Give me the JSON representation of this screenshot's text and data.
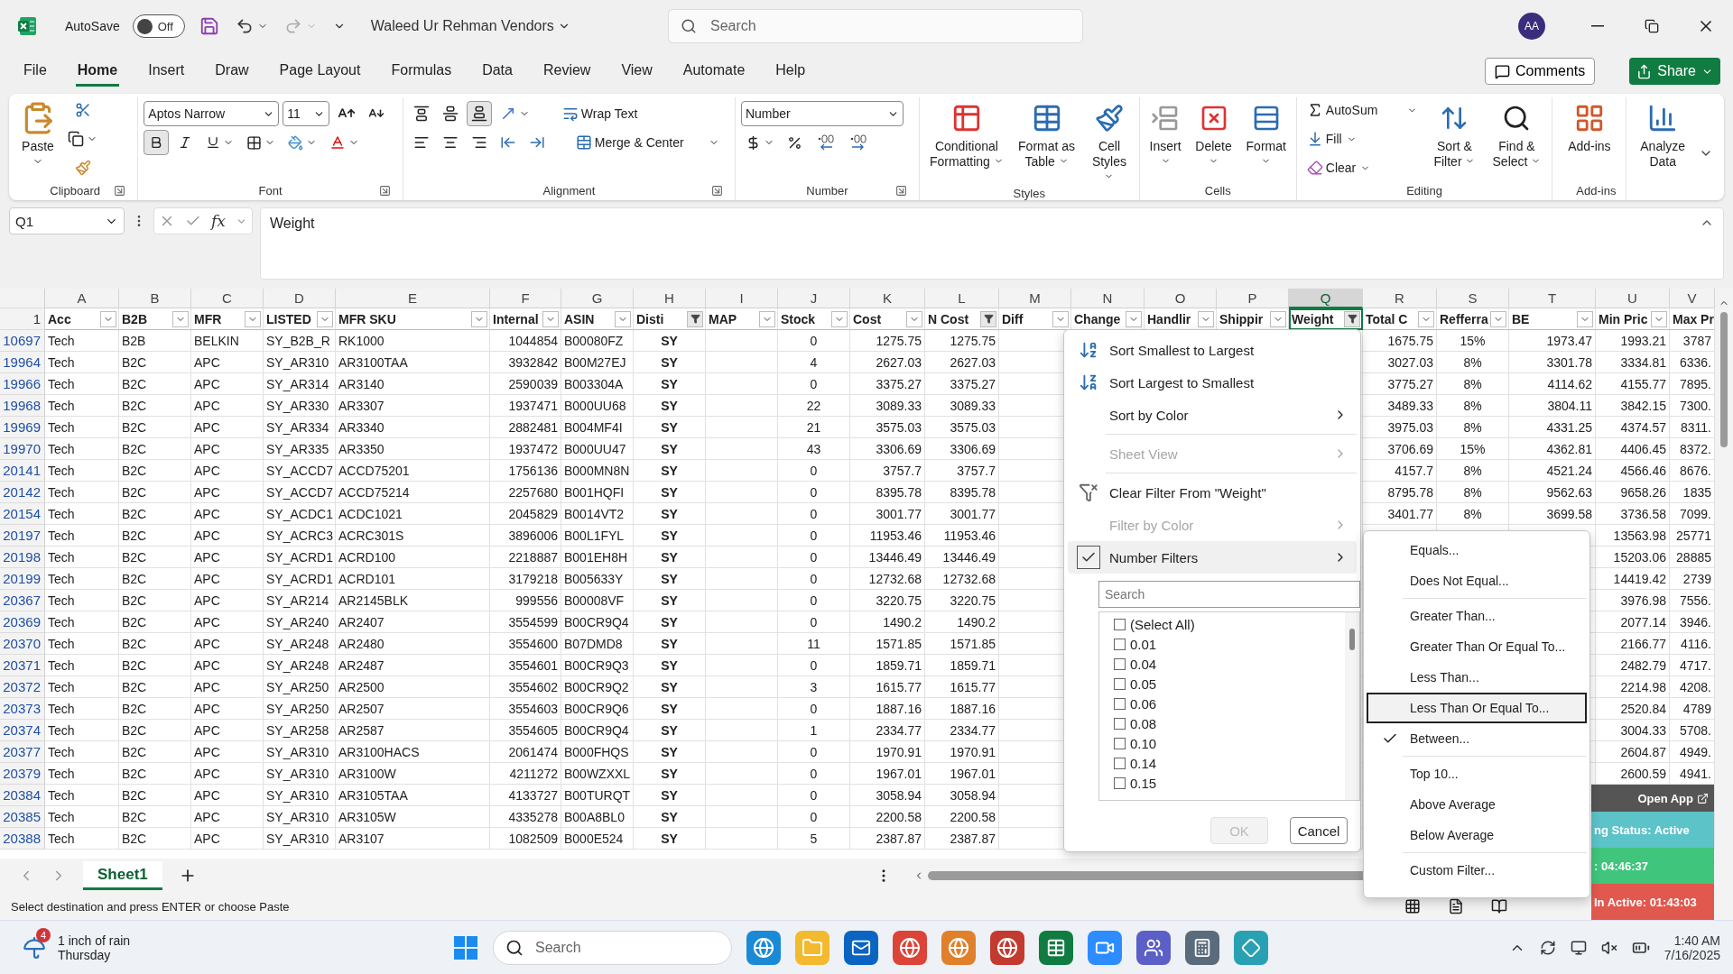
{
  "titlebar": {
    "autosave": {
      "label": "AutoSave",
      "state": "Off",
      "on": false
    },
    "title": "Waleed Ur Rehman Vendors",
    "search": {
      "placeholder": "Search"
    },
    "avatar": "AA"
  },
  "menu_tabs": [
    {
      "label": "File",
      "selected": false
    },
    {
      "label": "Home",
      "selected": true
    },
    {
      "label": "Insert",
      "selected": false
    },
    {
      "label": "Draw",
      "selected": false
    },
    {
      "label": "Page Layout",
      "selected": false
    },
    {
      "label": "Formulas",
      "selected": false
    },
    {
      "label": "Data",
      "selected": false
    },
    {
      "label": "Review",
      "selected": false
    },
    {
      "label": "View",
      "selected": false
    },
    {
      "label": "Automate",
      "selected": false
    },
    {
      "label": "Help",
      "selected": false
    }
  ],
  "actions": {
    "comments": "Comments",
    "share": "Share"
  },
  "ribbon": {
    "clipboard": {
      "label": "Clipboard",
      "paste": "Paste"
    },
    "font": {
      "label": "Font",
      "font": "Aptos Narrow",
      "size": "11",
      "bold": true
    },
    "alignment": {
      "label": "Alignment",
      "wrap": "Wrap Text",
      "merge": "Merge & Center",
      "bottom_align": true
    },
    "number": {
      "label": "Number",
      "format": "Number"
    },
    "styles": {
      "label": "Styles",
      "buttons": [
        "Conditional Formatting",
        "Format as Table",
        "Cell Styles"
      ]
    },
    "cells": {
      "label": "Cells",
      "buttons": [
        "Insert",
        "Delete",
        "Format"
      ]
    },
    "editing": {
      "label": "Editing",
      "small": [
        "AutoSum",
        "Fill",
        "Clear"
      ],
      "buttons": [
        "Sort & Filter",
        "Find & Select"
      ]
    },
    "addins": {
      "label": "Add-ins",
      "buttons": [
        "Add-ins"
      ]
    },
    "analyze": {
      "buttons": [
        "Analyze Data"
      ]
    }
  },
  "formula_bar": {
    "name_box": "Q1",
    "fx": "fx",
    "formula": "Weight"
  },
  "sheet": {
    "header_row": "1",
    "columns": [
      {
        "letter": "A",
        "header": "Acc",
        "filtered": false,
        "selected": false
      },
      {
        "letter": "B",
        "header": "B2B",
        "filtered": false,
        "selected": false
      },
      {
        "letter": "C",
        "header": "MFR",
        "filtered": false,
        "selected": false
      },
      {
        "letter": "D",
        "header": "LISTED",
        "filtered": false,
        "selected": false
      },
      {
        "letter": "E",
        "header": "MFR SKU",
        "filtered": false,
        "selected": false
      },
      {
        "letter": "F",
        "header": "Internal",
        "filtered": false,
        "selected": false
      },
      {
        "letter": "G",
        "header": "ASIN",
        "filtered": false,
        "selected": false
      },
      {
        "letter": "H",
        "header": "Disti",
        "filtered": true,
        "selected": false
      },
      {
        "letter": "I",
        "header": "MAP",
        "filtered": false,
        "selected": false
      },
      {
        "letter": "J",
        "header": "Stock",
        "filtered": false,
        "selected": false
      },
      {
        "letter": "K",
        "header": "Cost",
        "filtered": false,
        "selected": false
      },
      {
        "letter": "L",
        "header": "N Cost",
        "filtered": true,
        "selected": false
      },
      {
        "letter": "M",
        "header": "Diff",
        "filtered": false,
        "selected": false
      },
      {
        "letter": "N",
        "header": "Change",
        "filtered": false,
        "selected": false
      },
      {
        "letter": "O",
        "header": "Handlir",
        "filtered": false,
        "selected": false
      },
      {
        "letter": "P",
        "header": "Shippir",
        "filtered": false,
        "selected": false
      },
      {
        "letter": "Q",
        "header": "Weight",
        "filtered": true,
        "selected": true
      },
      {
        "letter": "R",
        "header": "Total C",
        "filtered": false,
        "selected": false
      },
      {
        "letter": "S",
        "header": "Refferra",
        "filtered": false,
        "selected": false
      },
      {
        "letter": "T",
        "header": "BE",
        "filtered": false,
        "selected": false
      },
      {
        "letter": "U",
        "header": "Min Pric",
        "filtered": false,
        "selected": false
      },
      {
        "letter": "V",
        "header": "Max Pr",
        "selected": false
      }
    ],
    "rows": [
      {
        "num": "10697",
        "cells": [
          "Tech",
          "B2B",
          "BELKIN",
          "SY_B2B_R",
          "RK1000",
          "1044854",
          "B00080FZ",
          "SY",
          "",
          "0",
          "1275.75",
          "1275.75"
        ],
        "tail": [
          "1675.75",
          "15%",
          "1973.47",
          "1993.21",
          "3787"
        ]
      },
      {
        "num": "19964",
        "cells": [
          "Tech",
          "B2C",
          "APC",
          "SY_AR310",
          "AR3100TAA",
          "3932842",
          "B00M27EJ",
          "SY",
          "",
          "4",
          "2627.03",
          "2627.03"
        ],
        "tail": [
          "3027.03",
          "8%",
          "3301.78",
          "3334.81",
          "6336."
        ]
      },
      {
        "num": "19966",
        "cells": [
          "Tech",
          "B2C",
          "APC",
          "SY_AR314",
          "AR3140",
          "2590039",
          "B003304A",
          "SY",
          "",
          "0",
          "3375.27",
          "3375.27"
        ],
        "tail": [
          "3775.27",
          "8%",
          "4114.62",
          "4155.77",
          "7895."
        ]
      },
      {
        "num": "19968",
        "cells": [
          "Tech",
          "B2C",
          "APC",
          "SY_AR330",
          "AR3307",
          "1937471",
          "B000UU68",
          "SY",
          "",
          "22",
          "3089.33",
          "3089.33"
        ],
        "tail": [
          "3489.33",
          "8%",
          "3804.11",
          "3842.15",
          "7300."
        ]
      },
      {
        "num": "19969",
        "cells": [
          "Tech",
          "B2C",
          "APC",
          "SY_AR334",
          "AR3340",
          "2882481",
          "B004MF4I",
          "SY",
          "",
          "21",
          "3575.03",
          "3575.03"
        ],
        "tail": [
          "3975.03",
          "8%",
          "4331.25",
          "4374.57",
          "8311."
        ]
      },
      {
        "num": "19970",
        "cells": [
          "Tech",
          "B2C",
          "APC",
          "SY_AR335",
          "AR3350",
          "1937472",
          "B000UU47",
          "SY",
          "",
          "43",
          "3306.69",
          "3306.69"
        ],
        "tail": [
          "3706.69",
          "15%",
          "4362.81",
          "4406.45",
          "8372."
        ]
      },
      {
        "num": "20141",
        "cells": [
          "Tech",
          "B2C",
          "APC",
          "SY_ACCD7",
          "ACCD75201",
          "1756136",
          "B000MN8N",
          "SY",
          "",
          "0",
          "3757.7",
          "3757.7"
        ],
        "tail": [
          "4157.7",
          "8%",
          "4521.24",
          "4566.46",
          "8676."
        ]
      },
      {
        "num": "20142",
        "cells": [
          "Tech",
          "B2C",
          "APC",
          "SY_ACCD7",
          "ACCD75214",
          "2257680",
          "B001HQFI",
          "SY",
          "",
          "0",
          "8395.78",
          "8395.78"
        ],
        "tail": [
          "8795.78",
          "8%",
          "9562.63",
          "9658.26",
          "1835"
        ]
      },
      {
        "num": "20154",
        "cells": [
          "Tech",
          "B2C",
          "APC",
          "SY_ACDC1",
          "ACDC1021",
          "2045829",
          "B0014VT2",
          "SY",
          "",
          "0",
          "3001.77",
          "3001.77"
        ],
        "tail": [
          "3401.77",
          "8%",
          "3699.58",
          "3736.58",
          "7099."
        ]
      },
      {
        "num": "20197",
        "cells": [
          "Tech",
          "B2C",
          "APC",
          "SY_ACRC3",
          "ACRC301S",
          "3896006",
          "B00L1FYL",
          "SY",
          "",
          "0",
          "11953.46",
          "11953.46"
        ],
        "tail": [
          "13563.98",
          "25771"
        ]
      },
      {
        "num": "20198",
        "cells": [
          "Tech",
          "B2C",
          "APC",
          "SY_ACRD1",
          "ACRD100",
          "2218887",
          "B001EH8H",
          "SY",
          "",
          "0",
          "13446.49",
          "13446.49"
        ],
        "tail": [
          "15203.06",
          "28885"
        ]
      },
      {
        "num": "20199",
        "cells": [
          "Tech",
          "B2C",
          "APC",
          "SY_ACRD1",
          "ACRD101",
          "3179218",
          "B005633Y",
          "SY",
          "",
          "0",
          "12732.68",
          "12732.68"
        ],
        "tail": [
          "14419.42",
          "2739"
        ]
      },
      {
        "num": "20367",
        "cells": [
          "Tech",
          "B2C",
          "APC",
          "SY_AR214",
          "AR2145BLK",
          "999556",
          "B00008VF",
          "SY",
          "",
          "0",
          "3220.75",
          "3220.75"
        ],
        "tail": [
          "3976.98",
          "7556."
        ]
      },
      {
        "num": "20369",
        "cells": [
          "Tech",
          "B2C",
          "APC",
          "SY_AR240",
          "AR2407",
          "3554599",
          "B00CR9Q4",
          "SY",
          "",
          "0",
          "1490.2",
          "1490.2"
        ],
        "tail": [
          "2077.14",
          "3946."
        ]
      },
      {
        "num": "20370",
        "cells": [
          "Tech",
          "B2C",
          "APC",
          "SY_AR248",
          "AR2480",
          "3554600",
          "B07DMD8",
          "SY",
          "",
          "11",
          "1571.85",
          "1571.85"
        ],
        "tail": [
          "2166.77",
          "4116."
        ]
      },
      {
        "num": "20371",
        "cells": [
          "Tech",
          "B2C",
          "APC",
          "SY_AR248",
          "AR2487",
          "3554601",
          "B00CR9Q3",
          "SY",
          "",
          "0",
          "1859.71",
          "1859.71"
        ],
        "tail": [
          "2482.79",
          "4717."
        ]
      },
      {
        "num": "20372",
        "cells": [
          "Tech",
          "B2C",
          "APC",
          "SY_AR250",
          "AR2500",
          "3554602",
          "B00CR9Q2",
          "SY",
          "",
          "3",
          "1615.77",
          "1615.77"
        ],
        "tail": [
          "2214.98",
          "4208."
        ]
      },
      {
        "num": "20373",
        "cells": [
          "Tech",
          "B2C",
          "APC",
          "SY_AR250",
          "AR2507",
          "3554603",
          "B00CR9Q6",
          "SY",
          "",
          "0",
          "1887.16",
          "1887.16"
        ],
        "tail": [
          "2520.84",
          "4789"
        ]
      },
      {
        "num": "20374",
        "cells": [
          "Tech",
          "B2C",
          "APC",
          "SY_AR258",
          "AR2587",
          "3554605",
          "B00CR9Q4",
          "SY",
          "",
          "1",
          "2334.77",
          "2334.77"
        ],
        "tail": [
          "3004.33",
          "5708."
        ]
      },
      {
        "num": "20377",
        "cells": [
          "Tech",
          "B2C",
          "APC",
          "SY_AR310",
          "AR3100HACS",
          "2061474",
          "B000FHQS",
          "SY",
          "",
          "0",
          "1970.91",
          "1970.91"
        ],
        "tail": [
          "2604.87",
          "4949."
        ]
      },
      {
        "num": "20379",
        "cells": [
          "Tech",
          "B2C",
          "APC",
          "SY_AR310",
          "AR3100W",
          "4211272",
          "B00WZXXL",
          "SY",
          "",
          "0",
          "1967.01",
          "1967.01"
        ],
        "tail": [
          "2600.59",
          "4941."
        ]
      },
      {
        "num": "20384",
        "cells": [
          "Tech",
          "B2C",
          "APC",
          "SY_AR310",
          "AR3105TAA",
          "4133727",
          "B00TURQT",
          "SY",
          "",
          "0",
          "3058.94",
          "3058.94"
        ]
      },
      {
        "num": "20385",
        "cells": [
          "Tech",
          "B2C",
          "APC",
          "SY_AR310",
          "AR3105W",
          "4335278",
          "B00A8BL0",
          "SY",
          "",
          "0",
          "2200.58",
          "2200.58"
        ]
      },
      {
        "num": "20388",
        "cells": [
          "Tech",
          "B2C",
          "APC",
          "SY_AR310",
          "AR3107",
          "1082509",
          "B000E524",
          "SY",
          "",
          "5",
          "2387.87",
          "2387.87"
        ]
      }
    ]
  },
  "filter_menu": {
    "items": [
      {
        "kind": "sort_asc",
        "label": "Sort Smallest to Largest",
        "disabled": false,
        "submenu": false,
        "checked": false,
        "selected": false,
        "separator_before": false
      },
      {
        "kind": "sort_desc",
        "label": "Sort Largest to Smallest",
        "disabled": false,
        "submenu": false,
        "checked": false,
        "selected": false,
        "separator_before": false
      },
      {
        "kind": "plain",
        "label": "Sort by Color",
        "disabled": false,
        "submenu": true,
        "checked": false,
        "selected": false,
        "separator_before": false
      },
      {
        "kind": "plain",
        "label": "Sheet View",
        "disabled": true,
        "submenu": true,
        "checked": false,
        "selected": false,
        "separator_before": true
      },
      {
        "kind": "clear",
        "label": "Clear Filter From \"Weight\"",
        "disabled": false,
        "submenu": false,
        "checked": false,
        "selected": false,
        "separator_before": true
      },
      {
        "kind": "plain",
        "label": "Filter by Color",
        "disabled": true,
        "submenu": true,
        "checked": false,
        "selected": false,
        "separator_before": false
      },
      {
        "kind": "checkbox",
        "label": "Number Filters",
        "disabled": false,
        "submenu": true,
        "checked": true,
        "selected": true,
        "separator_before": false
      }
    ],
    "search": {
      "placeholder": "Search"
    },
    "values": [
      {
        "label": "(Select All)",
        "checked": false
      },
      {
        "label": "0.01",
        "checked": false
      },
      {
        "label": "0.04",
        "checked": false
      },
      {
        "label": "0.05",
        "checked": false
      },
      {
        "label": "0.06",
        "checked": false
      },
      {
        "label": "0.08",
        "checked": false
      },
      {
        "label": "0.10",
        "checked": false
      },
      {
        "label": "0.14",
        "checked": false
      },
      {
        "label": "0.15",
        "checked": false
      }
    ],
    "ok": "OK",
    "ok_disabled": true,
    "cancel": "Cancel"
  },
  "number_filters": {
    "items": [
      {
        "label": "Equals...",
        "checked": false,
        "selected": false,
        "separator_before": false
      },
      {
        "label": "Does Not Equal...",
        "checked": false,
        "selected": false,
        "separator_before": false
      },
      {
        "label": "Greater Than...",
        "checked": false,
        "selected": false,
        "separator_before": true
      },
      {
        "label": "Greater Than Or Equal To...",
        "checked": false,
        "selected": false,
        "separator_before": false
      },
      {
        "label": "Less Than...",
        "checked": false,
        "selected": false,
        "separator_before": false
      },
      {
        "label": "Less Than Or Equal To...",
        "checked": false,
        "selected": true,
        "separator_before": false
      },
      {
        "label": "Between...",
        "checked": true,
        "selected": false,
        "separator_before": false
      },
      {
        "label": "Top 10...",
        "checked": false,
        "selected": false,
        "separator_before": true
      },
      {
        "label": "Above Average",
        "checked": false,
        "selected": false,
        "separator_before": false
      },
      {
        "label": "Below Average",
        "checked": false,
        "selected": false,
        "separator_before": false
      },
      {
        "label": "Custom Filter...",
        "checked": false,
        "selected": false,
        "separator_before": true
      }
    ]
  },
  "sheet_tabs": [
    {
      "label": "Sheet1",
      "selected": true
    }
  ],
  "status": "Select destination and press ENTER or choose Paste",
  "overlay": {
    "button": "Open App",
    "lines": [
      {
        "text": "ng Status: Active",
        "color": "#5cc3c9"
      },
      {
        "text": ": 04:46:37",
        "color": "#3fc57c"
      },
      {
        "text": "In Active: 01:43:03",
        "color": "#e0584e"
      }
    ]
  },
  "taskbar": {
    "weather": {
      "badge": "4",
      "title": "1 inch of rain",
      "subtitle": "Thursday"
    },
    "search": {
      "placeholder": "Search"
    },
    "time": "1:40 AM",
    "date": "7/16/2025"
  }
}
